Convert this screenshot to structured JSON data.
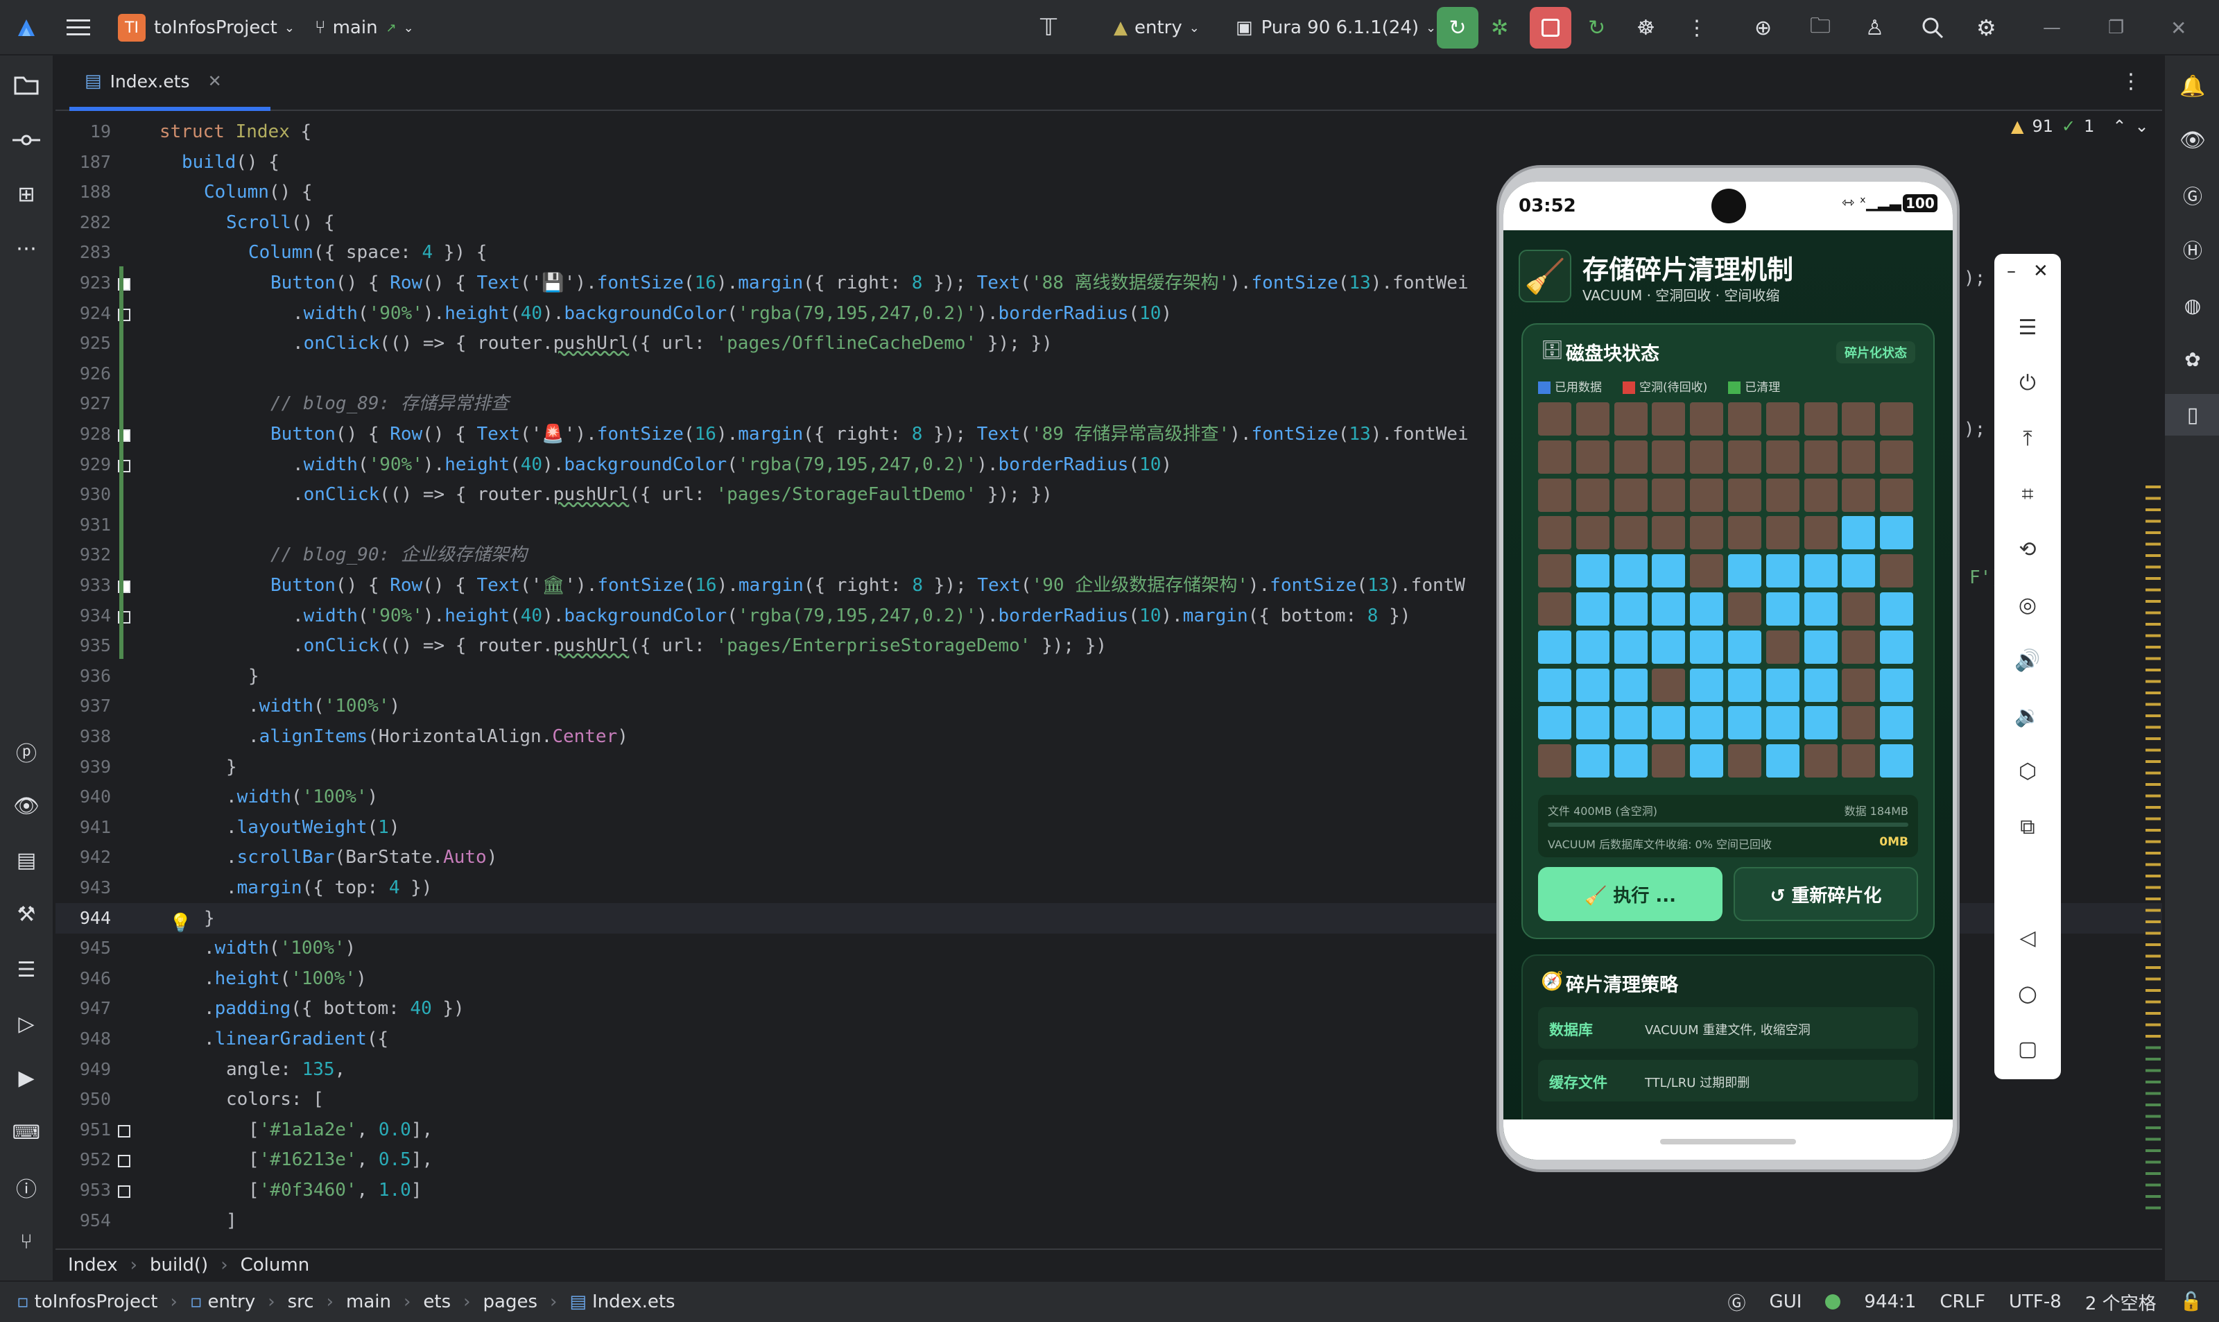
{
  "titlebar": {
    "project_initials": "TI",
    "project_name": "toInfosProject",
    "branch": "main",
    "run_config": "entry",
    "device": "Pura 90 6.1.1(24)"
  },
  "tabs": [
    {
      "label": "Index.ets"
    }
  ],
  "editor": {
    "warning_count": "91",
    "check_count": "1",
    "lines": [
      {
        "n": "19",
        "segments": [
          [
            "kw",
            "struct "
          ],
          [
            "cls",
            "Index"
          ],
          [
            "",
            " {"
          ]
        ],
        "indent": 0
      },
      {
        "n": "187",
        "segments": [
          [
            "fn",
            "build"
          ],
          [
            "",
            "() {"
          ]
        ],
        "indent": 1
      },
      {
        "n": "188",
        "segments": [
          [
            "fn",
            "Column"
          ],
          [
            "",
            "() {"
          ]
        ],
        "indent": 2
      },
      {
        "n": "282",
        "segments": [
          [
            "fn",
            "Scroll"
          ],
          [
            "",
            "() {"
          ]
        ],
        "indent": 3
      },
      {
        "n": "283",
        "segments": [
          [
            "fn",
            "Column"
          ],
          [
            "",
            "({ space: "
          ],
          [
            "num",
            "4"
          ],
          [
            "",
            " }) {"
          ]
        ],
        "indent": 4
      },
      {
        "n": "923",
        "mark": "filled",
        "segments": [
          [
            "fn",
            "Button"
          ],
          [
            "",
            "() { "
          ],
          [
            "fn",
            "Row"
          ],
          [
            "",
            "() { "
          ],
          [
            "fn",
            "Text"
          ],
          [
            "",
            "('"
          ],
          [
            "str",
            "💾"
          ],
          [
            "",
            "')."
          ],
          [
            "fn",
            "fontSize"
          ],
          [
            "",
            "("
          ],
          [
            "num",
            "16"
          ],
          [
            "",
            ")."
          ],
          [
            "fn",
            "margin"
          ],
          [
            "",
            "({ right: "
          ],
          [
            "num",
            "8"
          ],
          [
            "",
            " }); "
          ],
          [
            "fn",
            "Text"
          ],
          [
            "",
            "("
          ],
          [
            "str",
            "'88 离线数据缓存架构'"
          ],
          [
            "",
            ")."
          ],
          [
            "fn",
            "fontSize"
          ],
          [
            "",
            "("
          ],
          [
            "num",
            "13"
          ],
          [
            "",
            ").fontWei"
          ]
        ],
        "indent": 5
      },
      {
        "n": "924",
        "mark": "empty",
        "segments": [
          [
            "",
            "."
          ],
          [
            "fn",
            "width"
          ],
          [
            "",
            "("
          ],
          [
            "str",
            "'90%'"
          ],
          [
            "",
            ")."
          ],
          [
            "fn",
            "height"
          ],
          [
            "",
            "("
          ],
          [
            "num",
            "40"
          ],
          [
            "",
            ")."
          ],
          [
            "fn",
            "backgroundColor"
          ],
          [
            "",
            "("
          ],
          [
            "str",
            "'rgba(79,195,247,0.2)'"
          ],
          [
            "",
            ")."
          ],
          [
            "fn",
            "borderRadius"
          ],
          [
            "",
            "("
          ],
          [
            "num",
            "10"
          ],
          [
            "",
            ")"
          ]
        ],
        "indent": 6
      },
      {
        "n": "925",
        "segments": [
          [
            "",
            "."
          ],
          [
            "fn",
            "onClick"
          ],
          [
            "",
            "(() => { router."
          ],
          [
            "und",
            "pushUrl"
          ],
          [
            "",
            "({ url: "
          ],
          [
            "str",
            "'pages/OfflineCacheDemo'"
          ],
          [
            "",
            " }); })"
          ]
        ],
        "indent": 6
      },
      {
        "n": "926",
        "segments": [],
        "indent": 0
      },
      {
        "n": "927",
        "segments": [
          [
            "cm",
            "// blog_89: 存储异常排查"
          ]
        ],
        "indent": 5
      },
      {
        "n": "928",
        "mark": "filled",
        "segments": [
          [
            "fn",
            "Button"
          ],
          [
            "",
            "() { "
          ],
          [
            "fn",
            "Row"
          ],
          [
            "",
            "() { "
          ],
          [
            "fn",
            "Text"
          ],
          [
            "",
            "('"
          ],
          [
            "str",
            "🚨"
          ],
          [
            "",
            "')."
          ],
          [
            "fn",
            "fontSize"
          ],
          [
            "",
            "("
          ],
          [
            "num",
            "16"
          ],
          [
            "",
            ")."
          ],
          [
            "fn",
            "margin"
          ],
          [
            "",
            "({ right: "
          ],
          [
            "num",
            "8"
          ],
          [
            "",
            " }); "
          ],
          [
            "fn",
            "Text"
          ],
          [
            "",
            "("
          ],
          [
            "str",
            "'89 存储异常高级排查'"
          ],
          [
            "",
            ")."
          ],
          [
            "fn",
            "fontSize"
          ],
          [
            "",
            "("
          ],
          [
            "num",
            "13"
          ],
          [
            "",
            ").fontWei"
          ]
        ],
        "indent": 5
      },
      {
        "n": "929",
        "mark": "empty",
        "segments": [
          [
            "",
            "."
          ],
          [
            "fn",
            "width"
          ],
          [
            "",
            "("
          ],
          [
            "str",
            "'90%'"
          ],
          [
            "",
            ")."
          ],
          [
            "fn",
            "height"
          ],
          [
            "",
            "("
          ],
          [
            "num",
            "40"
          ],
          [
            "",
            ")."
          ],
          [
            "fn",
            "backgroundColor"
          ],
          [
            "",
            "("
          ],
          [
            "str",
            "'rgba(79,195,247,0.2)'"
          ],
          [
            "",
            ")."
          ],
          [
            "fn",
            "borderRadius"
          ],
          [
            "",
            "("
          ],
          [
            "num",
            "10"
          ],
          [
            "",
            ")"
          ]
        ],
        "indent": 6
      },
      {
        "n": "930",
        "segments": [
          [
            "",
            "."
          ],
          [
            "fn",
            "onClick"
          ],
          [
            "",
            "(() => { router."
          ],
          [
            "und",
            "pushUrl"
          ],
          [
            "",
            "({ url: "
          ],
          [
            "str",
            "'pages/StorageFaultDemo'"
          ],
          [
            "",
            " }); })"
          ]
        ],
        "indent": 6
      },
      {
        "n": "931",
        "segments": [],
        "indent": 0
      },
      {
        "n": "932",
        "segments": [
          [
            "cm",
            "// blog_90: 企业级存储架构"
          ]
        ],
        "indent": 5
      },
      {
        "n": "933",
        "mark": "filled",
        "segments": [
          [
            "fn",
            "Button"
          ],
          [
            "",
            "() { "
          ],
          [
            "fn",
            "Row"
          ],
          [
            "",
            "() { "
          ],
          [
            "fn",
            "Text"
          ],
          [
            "",
            "('"
          ],
          [
            "str",
            "🏛"
          ],
          [
            "",
            "')."
          ],
          [
            "fn",
            "fontSize"
          ],
          [
            "",
            "("
          ],
          [
            "num",
            "16"
          ],
          [
            "",
            ")."
          ],
          [
            "fn",
            "margin"
          ],
          [
            "",
            "({ right: "
          ],
          [
            "num",
            "8"
          ],
          [
            "",
            " }); "
          ],
          [
            "fn",
            "Text"
          ],
          [
            "",
            "("
          ],
          [
            "str",
            "'90 企业级数据存储架构'"
          ],
          [
            "",
            ")."
          ],
          [
            "fn",
            "fontSize"
          ],
          [
            "",
            "("
          ],
          [
            "num",
            "13"
          ],
          [
            "",
            ").fontW"
          ]
        ],
        "indent": 5
      },
      {
        "n": "934",
        "mark": "empty",
        "segments": [
          [
            "",
            "."
          ],
          [
            "fn",
            "width"
          ],
          [
            "",
            "("
          ],
          [
            "str",
            "'90%'"
          ],
          [
            "",
            ")."
          ],
          [
            "fn",
            "height"
          ],
          [
            "",
            "("
          ],
          [
            "num",
            "40"
          ],
          [
            "",
            ")."
          ],
          [
            "fn",
            "backgroundColor"
          ],
          [
            "",
            "("
          ],
          [
            "str",
            "'rgba(79,195,247,0.2)'"
          ],
          [
            "",
            ")."
          ],
          [
            "fn",
            "borderRadius"
          ],
          [
            "",
            "("
          ],
          [
            "num",
            "10"
          ],
          [
            "",
            ")."
          ],
          [
            "fn",
            "margin"
          ],
          [
            "",
            "({ bottom: "
          ],
          [
            "num",
            "8"
          ],
          [
            "",
            " })"
          ]
        ],
        "indent": 6
      },
      {
        "n": "935",
        "segments": [
          [
            "",
            "."
          ],
          [
            "fn",
            "onClick"
          ],
          [
            "",
            "(() => { router."
          ],
          [
            "und",
            "pushUrl"
          ],
          [
            "",
            "({ url: "
          ],
          [
            "str",
            "'pages/EnterpriseStorageDemo'"
          ],
          [
            "",
            " }); })"
          ]
        ],
        "indent": 6
      },
      {
        "n": "936",
        "segments": [
          [
            "",
            "}"
          ]
        ],
        "indent": 4
      },
      {
        "n": "937",
        "segments": [
          [
            "",
            "."
          ],
          [
            "fn",
            "width"
          ],
          [
            "",
            "("
          ],
          [
            "str",
            "'100%'"
          ],
          [
            "",
            ")"
          ]
        ],
        "indent": 4
      },
      {
        "n": "938",
        "segments": [
          [
            "",
            "."
          ],
          [
            "fn",
            "alignItems"
          ],
          [
            "",
            "(HorizontalAlign."
          ],
          [
            "prop",
            "Center"
          ],
          [
            "",
            ")"
          ]
        ],
        "indent": 4
      },
      {
        "n": "939",
        "segments": [
          [
            "",
            "}"
          ]
        ],
        "indent": 3
      },
      {
        "n": "940",
        "segments": [
          [
            "",
            "."
          ],
          [
            "fn",
            "width"
          ],
          [
            "",
            "("
          ],
          [
            "str",
            "'100%'"
          ],
          [
            "",
            ")"
          ]
        ],
        "indent": 3
      },
      {
        "n": "941",
        "segments": [
          [
            "",
            "."
          ],
          [
            "fn",
            "layoutWeight"
          ],
          [
            "",
            "("
          ],
          [
            "num",
            "1"
          ],
          [
            "",
            ")"
          ]
        ],
        "indent": 3
      },
      {
        "n": "942",
        "segments": [
          [
            "",
            "."
          ],
          [
            "fn",
            "scrollBar"
          ],
          [
            "",
            "(BarState."
          ],
          [
            "prop",
            "Auto"
          ],
          [
            "",
            ")"
          ]
        ],
        "indent": 3
      },
      {
        "n": "943",
        "segments": [
          [
            "",
            "."
          ],
          [
            "fn",
            "margin"
          ],
          [
            "",
            "({ top: "
          ],
          [
            "num",
            "4"
          ],
          [
            "",
            " })"
          ]
        ],
        "indent": 3
      },
      {
        "n": "944",
        "segments": [
          [
            "",
            "}"
          ]
        ],
        "indent": 2,
        "current": true
      },
      {
        "n": "945",
        "segments": [
          [
            "",
            "."
          ],
          [
            "fn",
            "width"
          ],
          [
            "",
            "("
          ],
          [
            "str",
            "'100%'"
          ],
          [
            "",
            ")"
          ]
        ],
        "indent": 2
      },
      {
        "n": "946",
        "segments": [
          [
            "",
            "."
          ],
          [
            "fn",
            "height"
          ],
          [
            "",
            "("
          ],
          [
            "str",
            "'100%'"
          ],
          [
            "",
            ")"
          ]
        ],
        "indent": 2
      },
      {
        "n": "947",
        "segments": [
          [
            "",
            "."
          ],
          [
            "fn",
            "padding"
          ],
          [
            "",
            "({ bottom: "
          ],
          [
            "num",
            "40"
          ],
          [
            "",
            " })"
          ]
        ],
        "indent": 2
      },
      {
        "n": "948",
        "segments": [
          [
            "",
            "."
          ],
          [
            "fn",
            "linearGradient"
          ],
          [
            "",
            "({"
          ]
        ],
        "indent": 2
      },
      {
        "n": "949",
        "segments": [
          [
            "",
            "angle: "
          ],
          [
            "num",
            "135"
          ],
          [
            "",
            ","
          ]
        ],
        "indent": 3
      },
      {
        "n": "950",
        "segments": [
          [
            "",
            "colors: ["
          ]
        ],
        "indent": 3
      },
      {
        "n": "951",
        "mark": "empty",
        "segments": [
          [
            "",
            "["
          ],
          [
            "str",
            "'#1a1a2e'"
          ],
          [
            "",
            ", "
          ],
          [
            "num",
            "0.0"
          ],
          [
            "",
            "],"
          ]
        ],
        "indent": 4
      },
      {
        "n": "952",
        "mark": "empty",
        "segments": [
          [
            "",
            "["
          ],
          [
            "str",
            "'#16213e'"
          ],
          [
            "",
            ", "
          ],
          [
            "num",
            "0.5"
          ],
          [
            "",
            "],"
          ]
        ],
        "indent": 4
      },
      {
        "n": "953",
        "mark": "empty",
        "segments": [
          [
            "",
            "["
          ],
          [
            "str",
            "'#0f3460'"
          ],
          [
            "",
            ", "
          ],
          [
            "num",
            "1.0"
          ],
          [
            "",
            "]"
          ]
        ],
        "indent": 4
      },
      {
        "n": "954",
        "segments": [
          [
            "",
            "]"
          ]
        ],
        "indent": 3
      }
    ],
    "overflow_right": [
      ");",
      ");",
      "F')"
    ]
  },
  "breadcrumb": [
    "Index",
    "build()",
    "Column"
  ],
  "statusbar": {
    "path": [
      "toInfosProject",
      "entry",
      "src",
      "main",
      "ets",
      "pages",
      "Index.ets"
    ],
    "gui": "GUI",
    "position": "944:1",
    "line_ending": "CRLF",
    "encoding": "UTF-8",
    "indent": "2 个空格"
  },
  "phone": {
    "time": "03:52",
    "battery": "100",
    "app_title": "存储碎片清理机制",
    "app_subtitle": "VACUUM · 空洞回收 · 空间收缩",
    "disk_card_title": "磁盘块状态",
    "disk_badge": "碎片化状态",
    "legend": [
      "已用数据",
      "空洞(待回收)",
      "已清理"
    ],
    "grid_rows": [
      "HHHHHHHHHH",
      "HHHHHHHHHH",
      "HHHHHHHHHH",
      "HHHHHHHHUU",
      "HUUUHUUUUH",
      "HUUUUHUUHU",
      "UUUUUUHUHU",
      "UUUHUUUUHU",
      "UUUUUUUUHU",
      "HUUHUHUHHU"
    ],
    "file_info_left": "文件 400MB (含空洞)",
    "file_info_right": "数据 184MB",
    "vacuum_info_left": "VACUUM 后数据库文件收缩: 0% 空间已回收",
    "vacuum_info_right": "0MB",
    "exec_button": "🧹 执行 ...",
    "refrag_button": "↺ 重新碎片化",
    "strategy_title": "碎片清理策略",
    "strategies": [
      {
        "name": "数据库",
        "desc": "VACUUM 重建文件, 收缩空洞"
      },
      {
        "name": "缓存文件",
        "desc": "TTL/LRU 过期即删"
      }
    ]
  },
  "colors": {
    "accent": "#3574f0",
    "used": "#6b5144",
    "hole": "#4fc3f7",
    "green": "#6ee7a8"
  }
}
